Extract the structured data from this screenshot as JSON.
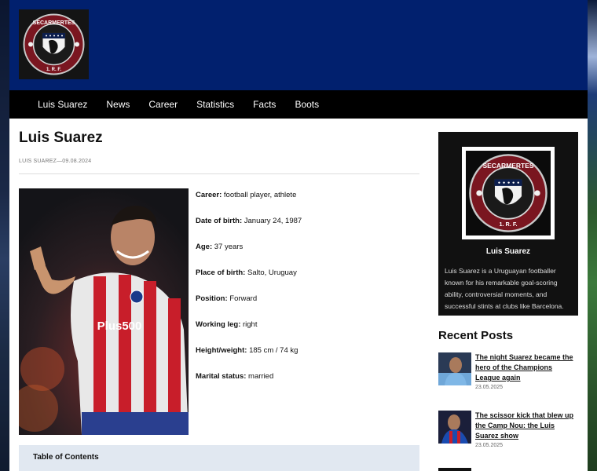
{
  "site": {
    "logo_text_top": "SECARMERTES",
    "logo_text_bottom": "1. R. F."
  },
  "nav": {
    "items": [
      "Luis Suarez",
      "News",
      "Career",
      "Statistics",
      "Facts",
      "Boots"
    ]
  },
  "article": {
    "title": "Luis Suarez",
    "meta": "LUIS SUAREZ—09.08.2024",
    "facts": [
      {
        "label": "Career:",
        "value": " football player, athlete"
      },
      {
        "label": "Date of birth:",
        "value": " January 24, 1987"
      },
      {
        "label": "Age:",
        "value": " 37 years"
      },
      {
        "label": "Place of birth:",
        "value": " Salto, Uruguay"
      },
      {
        "label": "Position:",
        "value": " Forward"
      },
      {
        "label": "Working leg:",
        "value": " right"
      },
      {
        "label": "Height/weight:",
        "value": " 185 cm / 74 kg"
      },
      {
        "label": "Marital status:",
        "value": " married"
      }
    ],
    "shirt_sponsor": "Plus500",
    "toc_title": "Table of Contents"
  },
  "sidebar": {
    "about_name": "Luis Suarez",
    "about_text": "Luis Suarez is a Uruguayan footballer known for his remarkable goal-scoring ability, controversial moments, and successful stints at clubs like Barcelona.",
    "recent_heading": "Recent Posts",
    "posts": [
      {
        "title": "The night Suarez became the hero of the Champions League again",
        "date": "23.05.2025"
      },
      {
        "title": "The scissor kick that blew up the Camp Nou: the Luis Suarez show",
        "date": "23.05.2025"
      }
    ]
  },
  "colors": {
    "header_bg": "#01206e",
    "nav_bg": "#000000",
    "toc_bg": "#e1e8f1",
    "badge_red": "#8b1a22"
  },
  "icons": [
    "club-badge-icon"
  ]
}
